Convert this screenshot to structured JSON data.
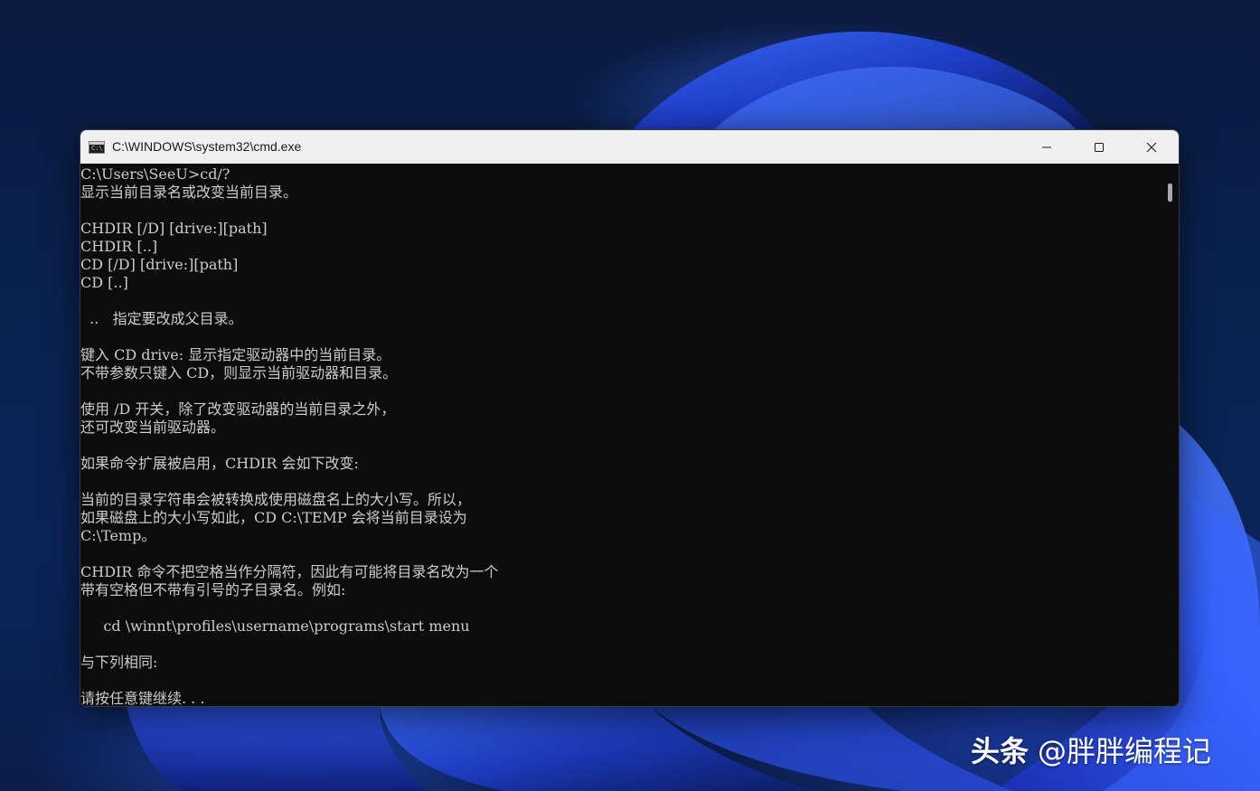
{
  "window": {
    "title": "C:\\WINDOWS\\system32\\cmd.exe",
    "app_icon_glyph": "C:\\",
    "controls": {
      "minimize_icon": "minimize-icon",
      "maximize_icon": "maximize-icon",
      "close_icon": "close-icon"
    }
  },
  "console": {
    "lines": [
      "C:\\Users\\SeeU>cd/?",
      "显示当前目录名或改变当前目录。",
      "",
      "CHDIR [/D] [drive:][path]",
      "CHDIR [..]",
      "CD [/D] [drive:][path]",
      "CD [..]",
      "",
      "  ..   指定要改成父目录。",
      "",
      "键入 CD drive: 显示指定驱动器中的当前目录。",
      "不带参数只键入 CD，则显示当前驱动器和目录。",
      "",
      "使用 /D 开关，除了改变驱动器的当前目录之外，",
      "还可改变当前驱动器。",
      "",
      "如果命令扩展被启用，CHDIR 会如下改变:",
      "",
      "当前的目录字符串会被转换成使用磁盘名上的大小写。所以，",
      "如果磁盘上的大小写如此，CD C:\\TEMP 会将当前目录设为",
      "C:\\Temp。",
      "",
      "CHDIR 命令不把空格当作分隔符，因此有可能将目录名改为一个",
      "带有空格但不带有引号的子目录名。例如:",
      "",
      "     cd \\winnt\\profiles\\username\\programs\\start menu",
      "",
      "与下列相同:",
      "",
      "请按任意键继续. . ."
    ],
    "background": "#0c0c0c",
    "foreground": "#cccccc"
  },
  "watermark": {
    "brand": "头条",
    "author": "@胖胖编程记"
  }
}
